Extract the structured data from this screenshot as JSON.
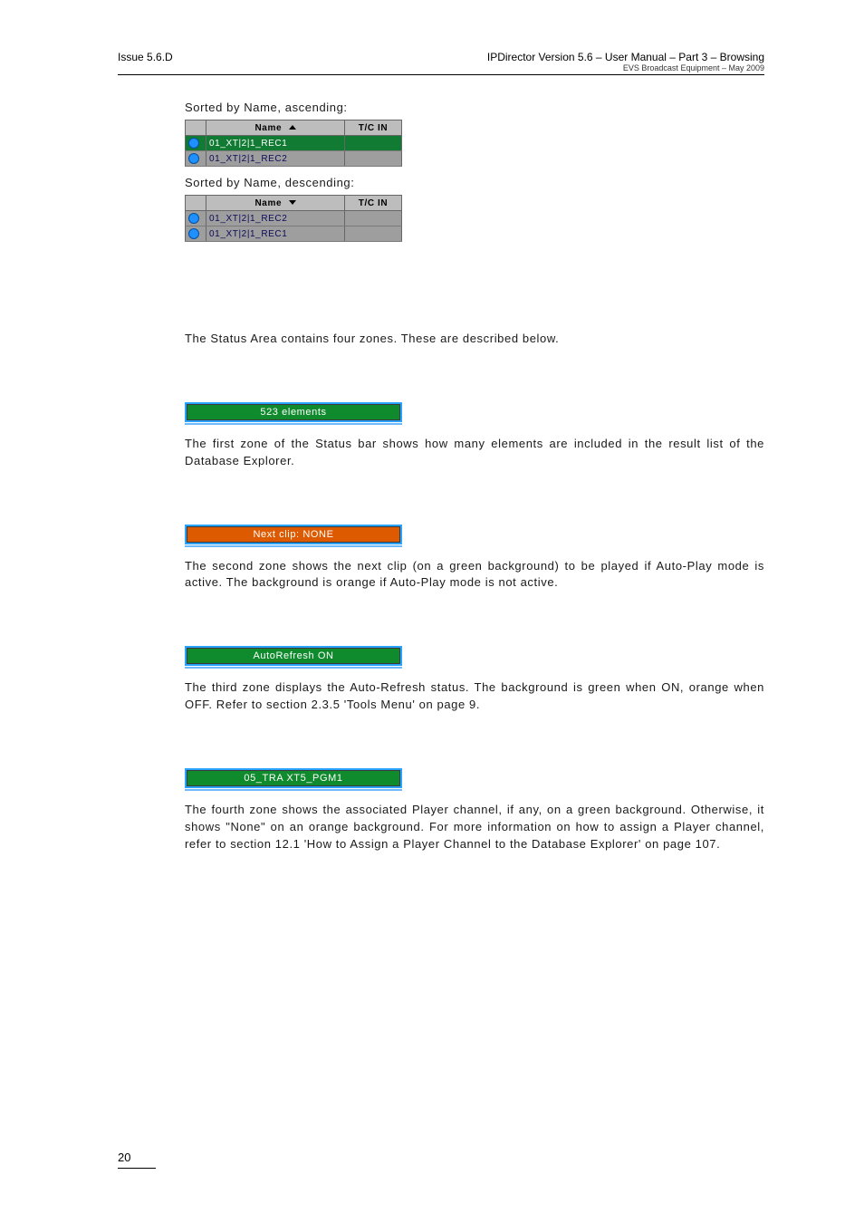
{
  "header": {
    "left": "Issue 5.6.D",
    "right_main": "IPDirector Version 5.6 – User Manual – Part 3 – Browsing",
    "right_sub": "EVS Broadcast Equipment – May 2009"
  },
  "sort_asc_caption": "Sorted by Name, ascending:",
  "sort_desc_caption": "Sorted by Name, descending:",
  "grid_headers": {
    "name": "Name",
    "tc": "T/C IN"
  },
  "asc_rows": [
    "01_XT|2|1_REC1",
    "01_XT|2|1_REC2"
  ],
  "desc_rows": [
    "01_XT|2|1_REC2",
    "01_XT|2|1_REC1"
  ],
  "status_intro": "The Status Area contains four zones. These are described below.",
  "zone1": {
    "bar_text": "523 elements",
    "desc": "The first zone of the Status bar shows how many elements are included in the result list of the Database Explorer."
  },
  "zone2": {
    "bar_text": "Next clip: NONE",
    "desc": "The second zone shows the next clip (on a green background) to be played if Auto-Play mode is active. The background is orange if Auto-Play mode is not active."
  },
  "zone3": {
    "bar_text": "AutoRefresh ON",
    "desc": "The third zone displays the Auto-Refresh status. The background is green when ON, orange when OFF. Refer to section 2.3.5 'Tools Menu' on page 9."
  },
  "zone4": {
    "bar_text": "05_TRA XT5_PGM1",
    "desc": "The fourth zone shows the associated Player channel, if any, on a green background. Otherwise, it shows \"None\" on an orange background. For more information on how to assign a Player channel, refer to section 12.1 'How to Assign a Player Channel to the Database Explorer' on page 107."
  },
  "page_number": "20"
}
